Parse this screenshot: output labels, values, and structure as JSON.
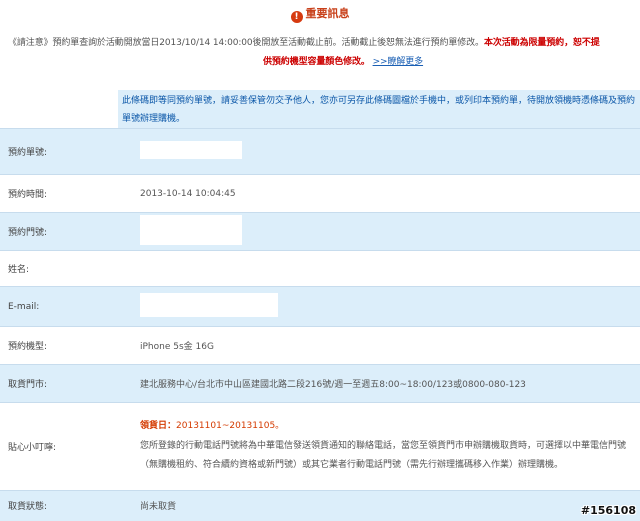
{
  "notice": {
    "icon": "exclamation-icon",
    "title": "重要訊息",
    "line1": "《請注意》預約單查詢於活動開放當日2013/10/14 14:00:00後開放至活動截止前。活動截止後恕無法進行預約單修改。",
    "line1_red": "本次活動為限量預約，恕不提",
    "line2_red": "供預約機型容量顏色修改。",
    "more_link": ">>瞭解更多"
  },
  "qr_note": "此條碼即等同預約單號，請妥善保管勿交予他人，您亦可另存此條碼圖檔於手機中，或列印本預約單，待開放領機時憑條碼及預約單號辦理購機。",
  "rows": [
    {
      "label": "預約單號:",
      "value": ""
    },
    {
      "label": "預約時間:",
      "value": "2013-10-14 10:04:45"
    },
    {
      "label": "預約門號:",
      "value": ""
    },
    {
      "label": "姓名:",
      "value": ""
    },
    {
      "label": "E-mail:",
      "value": ""
    },
    {
      "label": "預約機型:",
      "value": "iPhone 5s金 16G"
    },
    {
      "label": "取貨門市:",
      "value": "建北服務中心/台北市中山區建國北路二段216號/週一至週五8:00~18:00/123或0800-080-123"
    }
  ],
  "tip": {
    "label": "貼心小叮嚀:",
    "date_label": "領貨日：",
    "date_value": "20131101~20131105。",
    "text": "您所登錄的行動電話門號將為中華電信發送領貨通知的聯絡電話，當您至領貨門市申辦購機取貨時，可選擇以中華電信門號（無購機租約、符合續約資格或新門號）或其它業者行動電話門號（需先行辦理攜碼移入作業）辦理購機。"
  },
  "status": {
    "label": "取貨狀態:",
    "value": "尚未取貨"
  },
  "watermark": "#156108"
}
